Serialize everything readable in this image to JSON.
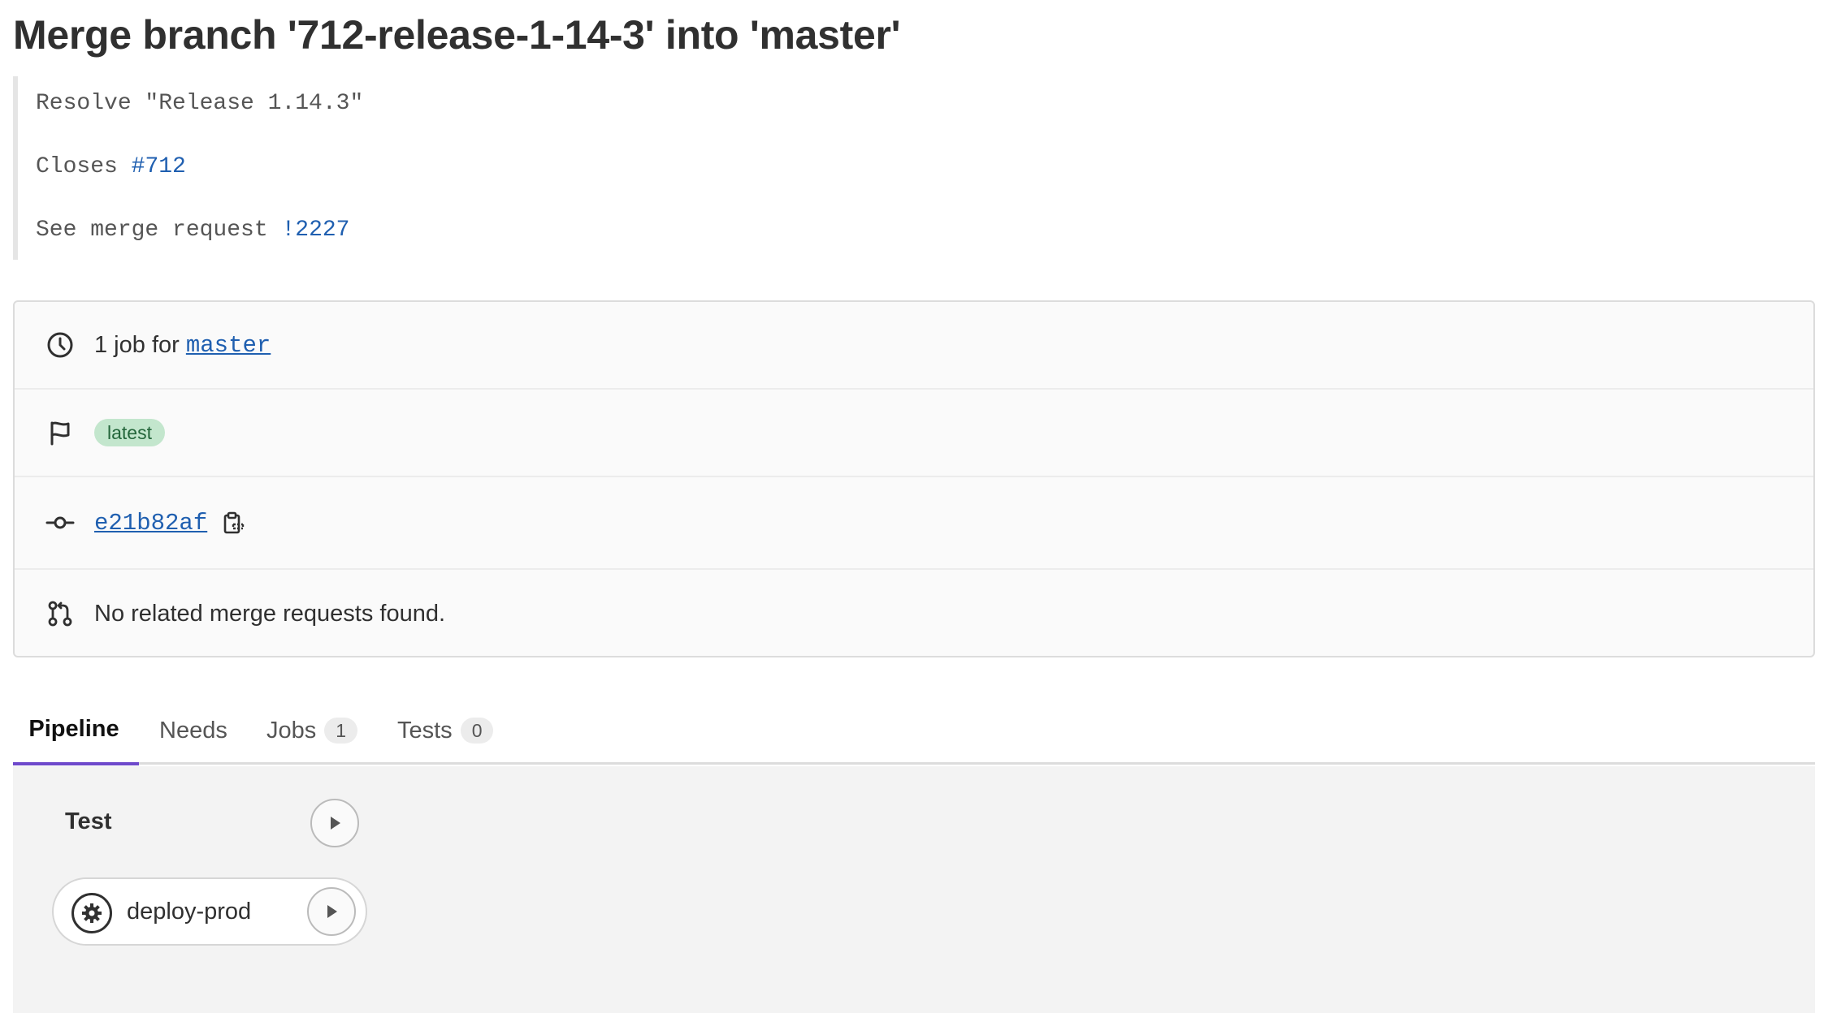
{
  "commit": {
    "title": "Merge branch '712-release-1-14-3' into 'master'",
    "message": {
      "line1": "Resolve \"Release 1.14.3\"",
      "line2_prefix": "Closes",
      "line2_ref": "#712",
      "line3_prefix": "See merge request",
      "line3_ref": "!2227"
    }
  },
  "info": {
    "jobs_text": "1 job for",
    "branch": "master",
    "badge": "latest",
    "sha": "e21b82af",
    "merge_requests_text": "No related merge requests found.",
    "icons": [
      "clock-icon",
      "flag-icon",
      "commit-icon",
      "clipboard-icon",
      "merge-request-icon"
    ]
  },
  "tabs": [
    {
      "label": "Pipeline",
      "count": null,
      "active": true
    },
    {
      "label": "Needs",
      "count": null,
      "active": false
    },
    {
      "label": "Jobs",
      "count": "1",
      "active": false
    },
    {
      "label": "Tests",
      "count": "0",
      "active": false
    }
  ],
  "pipeline": {
    "stage": "Test",
    "jobs": [
      {
        "name": "deploy-prod",
        "status_icon": "gear-icon",
        "action_icon": "play-icon"
      }
    ]
  },
  "colors": {
    "link": "#1f5fb0",
    "badge_bg": "#c3e6cd",
    "badge_text": "#24663b",
    "active_tab": "#6e49cb"
  }
}
